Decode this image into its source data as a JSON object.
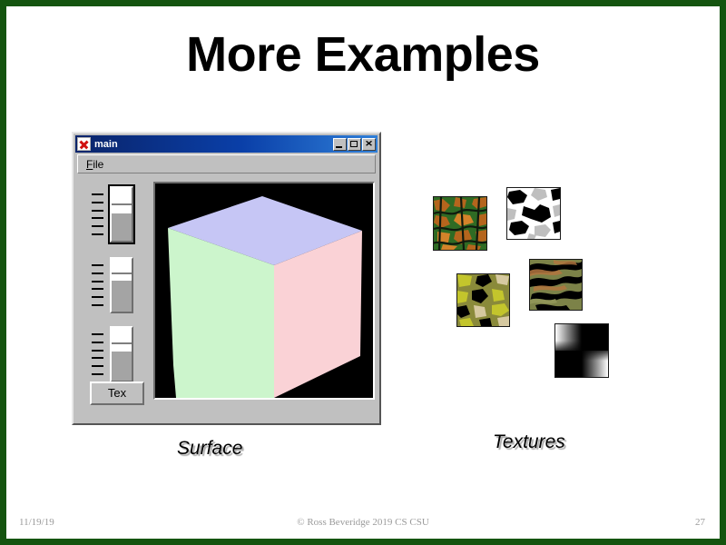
{
  "slide": {
    "title": "More Examples",
    "border_color": "#14540f",
    "background": "#ffffff"
  },
  "app_window": {
    "title": "main",
    "icon": "app-x-icon",
    "controls": {
      "minimize": "minimize-icon",
      "maximize": "maximize-icon",
      "close": "✕"
    },
    "menubar": {
      "items": [
        {
          "label": "File",
          "accel": "F",
          "rest": "ile"
        }
      ]
    },
    "sliders": [
      {
        "name": "slider-1",
        "focused": true,
        "value_pct": 52
      },
      {
        "name": "slider-2",
        "focused": false,
        "value_pct": 58
      },
      {
        "name": "slider-3",
        "focused": false,
        "value_pct": 55
      }
    ],
    "tex_button_label": "Tex",
    "canvas": {
      "background": "#000000",
      "object": "cube",
      "faces": {
        "top": "#c6c6f5",
        "left": "#ccf5cc",
        "right": "#fad2d6"
      }
    }
  },
  "captions": {
    "surface": "Surface",
    "textures": "Textures"
  },
  "textures": [
    {
      "name": "texture-green-orange-camo",
      "label": "green/orange blob camo",
      "colors": [
        "#1d4d1b",
        "#2f6b24",
        "#b5651d",
        "#d4832a",
        "#101a0e"
      ]
    },
    {
      "name": "texture-urban-bw-camo",
      "label": "black/white/grey urban camo",
      "colors": [
        "#ffffff",
        "#bfbfbf",
        "#8c8c8c",
        "#000000"
      ]
    },
    {
      "name": "texture-yellow-green-camo",
      "label": "yellow-green woodland camo",
      "colors": [
        "#c3c52c",
        "#8a8a3a",
        "#d6c9a0",
        "#000000",
        "#6f7030"
      ]
    },
    {
      "name": "texture-tiger-stripe-camo",
      "label": "olive tiger-stripe camo",
      "colors": [
        "#7c8248",
        "#5e6736",
        "#b4763f",
        "#000000",
        "#8f9457"
      ]
    },
    {
      "name": "texture-checkerboard",
      "label": "soft 2x2 checkerboard",
      "colors": [
        "#ffffff",
        "#000000"
      ]
    }
  ],
  "footer": {
    "date": "11/19/19",
    "copyright": "© Ross Beveridge  2019 CS CSU",
    "page": "27"
  }
}
